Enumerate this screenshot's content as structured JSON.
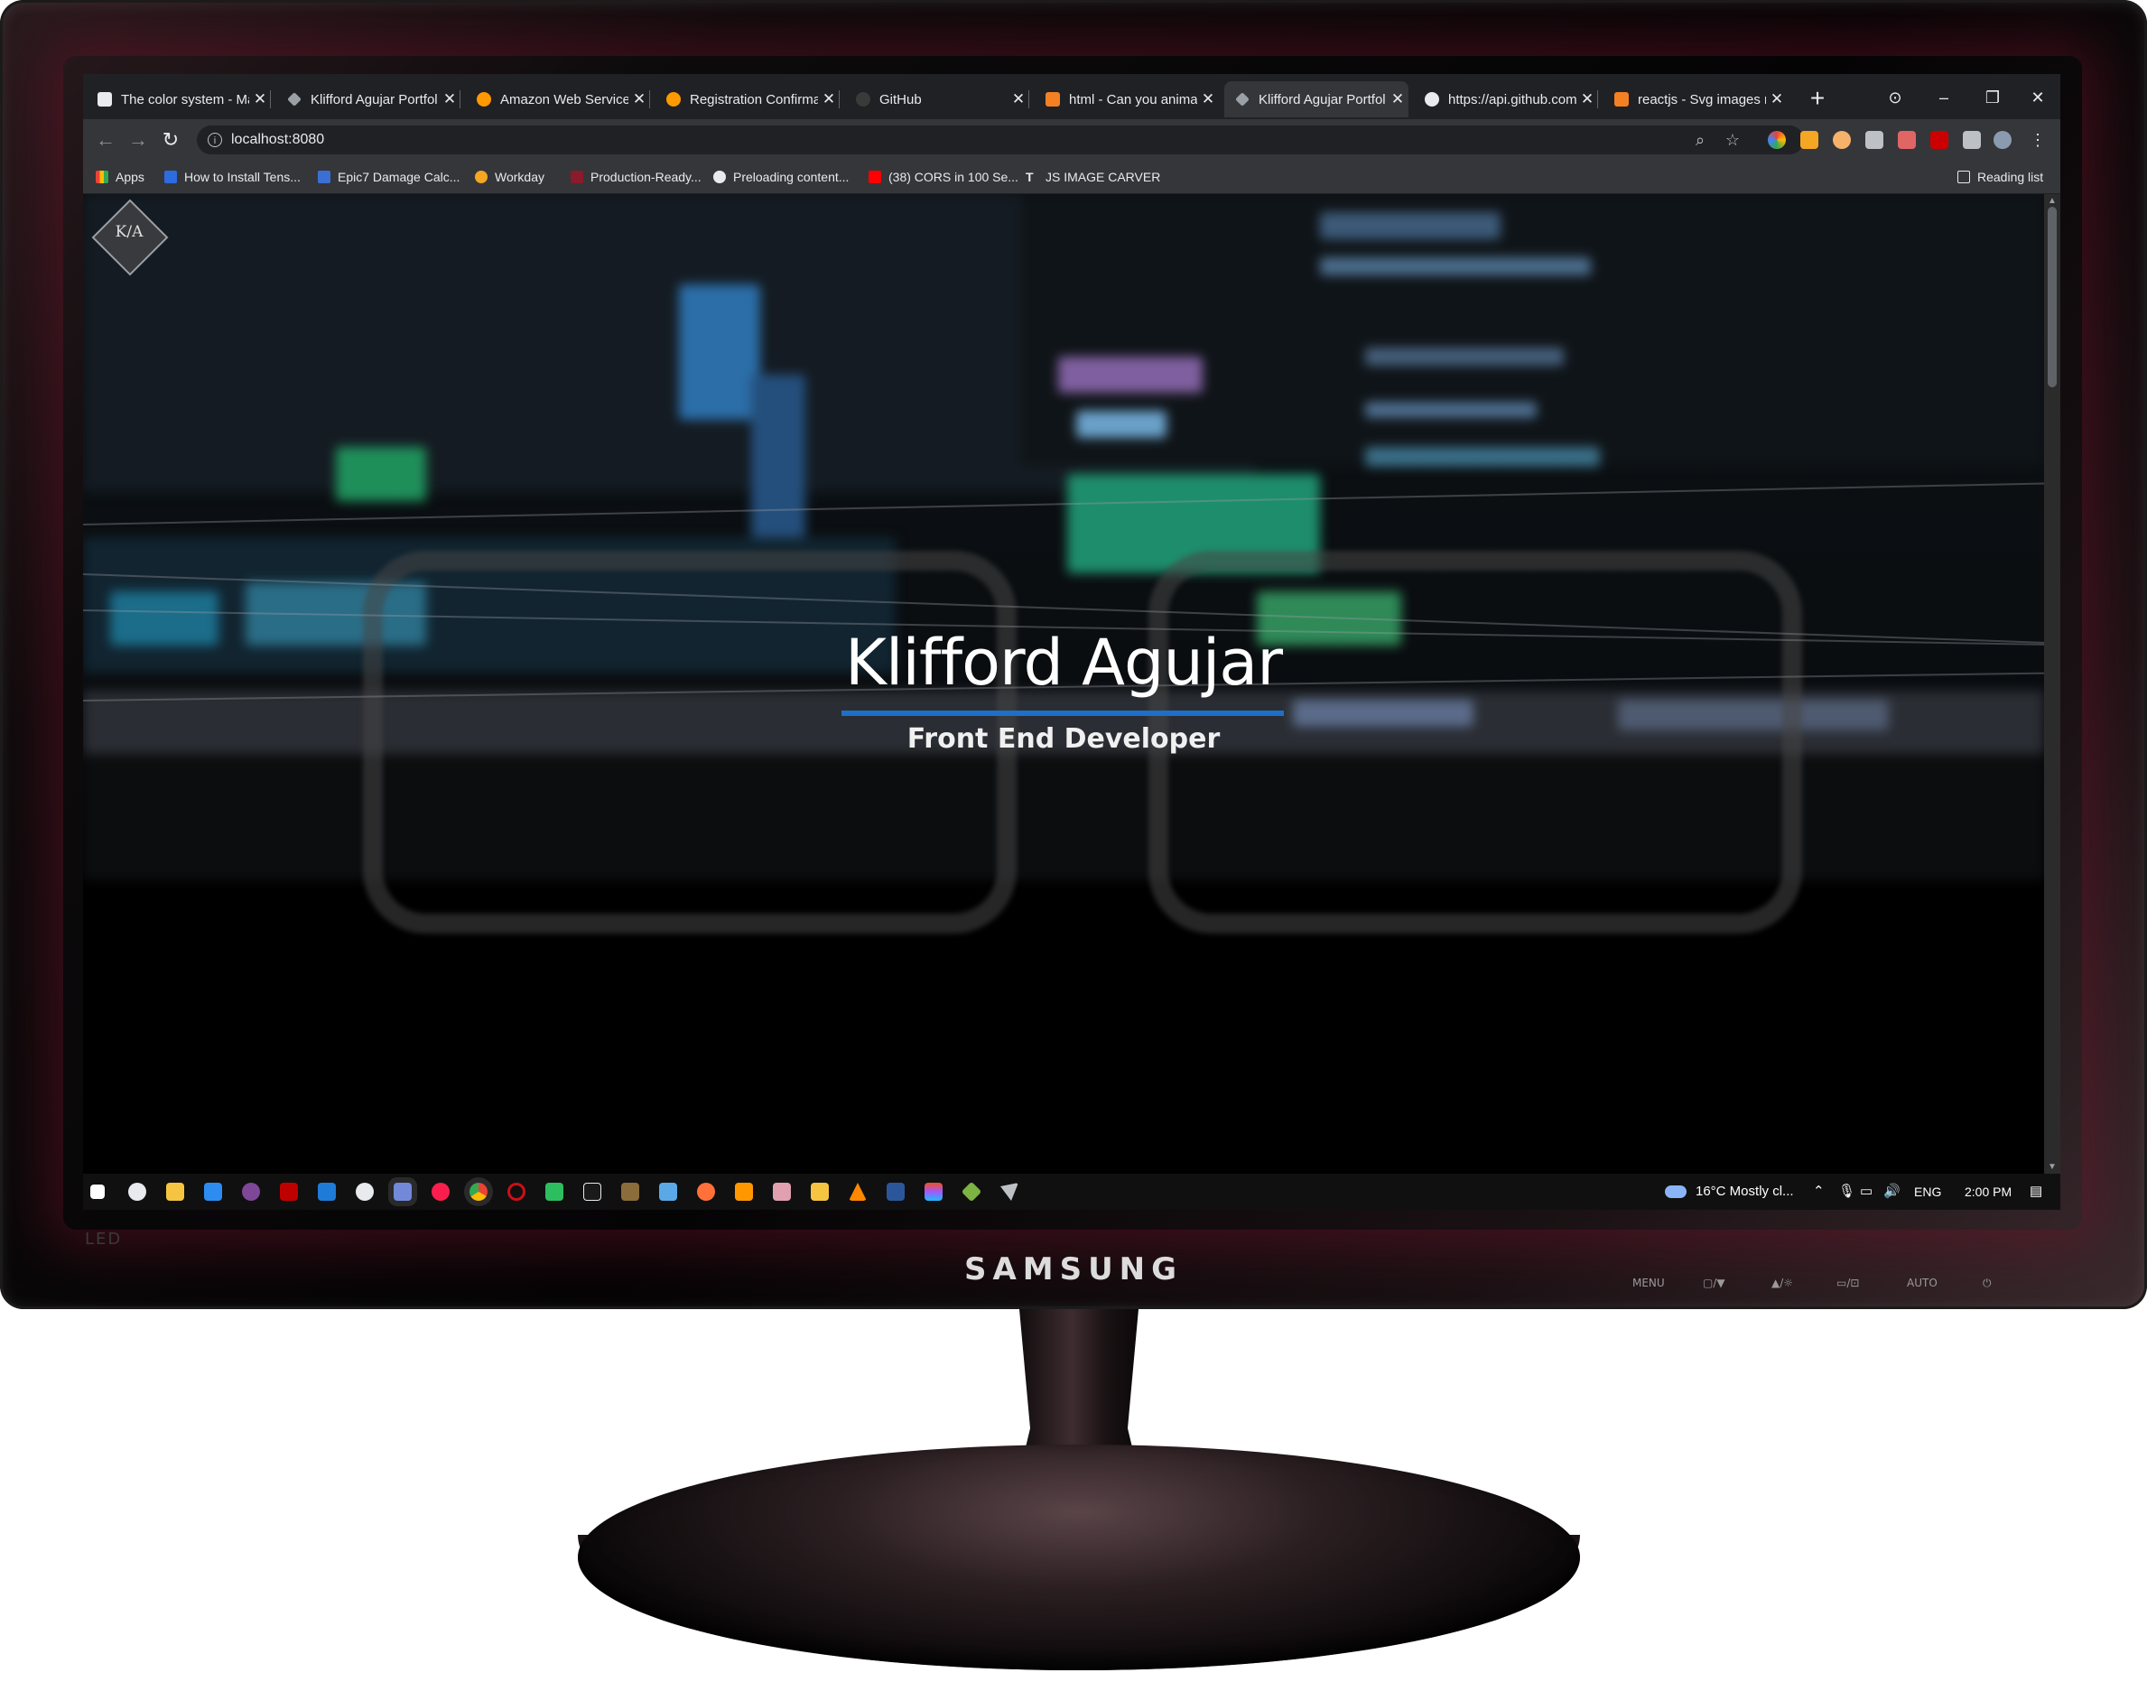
{
  "monitor": {
    "brand": "SAMSUNG",
    "led_label": "LED",
    "controls": [
      "MENU",
      "▢/▼",
      "▲/☼",
      "▭/⊡",
      "AUTO",
      "⏻"
    ]
  },
  "browser": {
    "tabs": [
      {
        "title": "The color system - Ma",
        "favicon": "document-icon",
        "color": "#e8eaed",
        "active": false
      },
      {
        "title": "Klifford Agujar Portfol",
        "favicon": "ka-diamond-icon",
        "color": "#9aa0a6",
        "active": false
      },
      {
        "title": "Amazon Web Services",
        "favicon": "aws-hex-icon",
        "color": "#ff9900",
        "active": false
      },
      {
        "title": "Registration Confirmat",
        "favicon": "aws-hex-icon",
        "color": "#ff9900",
        "active": false
      },
      {
        "title": "GitHub",
        "favicon": "github-icon",
        "color": "#24292e",
        "active": false
      },
      {
        "title": "html - Can you animat",
        "favicon": "stackoverflow-icon",
        "color": "#f48024",
        "active": false
      },
      {
        "title": "Klifford Agujar Portfol",
        "favicon": "ka-diamond-icon",
        "color": "#9aa0a6",
        "active": true
      },
      {
        "title": "https://api.github.com",
        "favicon": "globe-icon",
        "color": "#e8eaed",
        "active": false
      },
      {
        "title": "reactjs - Svg images n",
        "favicon": "stackoverflow-icon",
        "color": "#f48024",
        "active": false
      }
    ],
    "address": "localhost:8080",
    "bookmarks": [
      {
        "label": "Apps",
        "icon": "apps-grid-icon",
        "color": "#ea4335"
      },
      {
        "label": "How to Install Tens...",
        "icon": "bookmark-arrow-icon",
        "color": "#2d6cdf"
      },
      {
        "label": "Epic7 Damage Calc...",
        "icon": "epic7-icon",
        "color": "#3b6fd4"
      },
      {
        "label": "Workday",
        "icon": "workday-icon",
        "color": "#f5a623"
      },
      {
        "label": "Production-Ready...",
        "icon": "bookmark-arrow-icon",
        "color": "#8b1a2b"
      },
      {
        "label": "Preloading content...",
        "icon": "cloud-icon",
        "color": "#e8eaed"
      },
      {
        "label": "(38) CORS in 100 Se...",
        "icon": "youtube-icon",
        "color": "#ff0000"
      },
      {
        "label": "JS IMAGE CARVER",
        "icon": "t-icon",
        "color": "#e8eaed"
      }
    ],
    "reading_list": "Reading list"
  },
  "page": {
    "logo_text": "K/A",
    "name": "Klifford Agujar",
    "title": "Front End Developer"
  },
  "taskbar": {
    "apps": [
      "windows-start-icon",
      "xbox-icon",
      "file-explorer-icon",
      "mail-icon",
      "tor-icon",
      "filezilla-icon",
      "vscode-icon",
      "github-desktop-icon",
      "discord-icon",
      "opera-gx-icon",
      "chrome-icon",
      "opera-icon",
      "evernote-icon",
      "terminal-icon",
      "library-icon",
      "photos-icon",
      "firefox-icon",
      "sublime-icon",
      "paint-icon",
      "lightroom-icon",
      "vlc-icon",
      "word-icon",
      "figma-icon",
      "minecraft-icon",
      "snip-icon"
    ],
    "weather": "16°C  Mostly cl...",
    "language": "ENG",
    "time": "2:00 PM"
  }
}
